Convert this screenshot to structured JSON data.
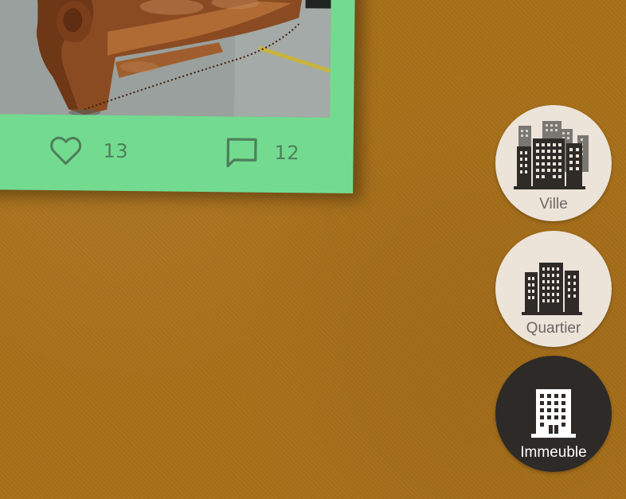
{
  "post": {
    "likes": "13",
    "comments": "12",
    "card_color": "#73db8f"
  },
  "icons": {
    "like": "heart-outline-icon",
    "comment": "comment-bubble-icon",
    "ville": "city-buildings-icon",
    "quartier": "district-buildings-icon",
    "immeuble": "single-building-icon"
  },
  "scale_selector": {
    "ville_label": "Ville",
    "quartier_label": "Quartier",
    "immeuble_label": "Immeuble",
    "selected": "Immeuble"
  },
  "colors": {
    "background": "#a8701a",
    "button_inactive": "#ece3d9",
    "button_active": "#2d2a27"
  }
}
